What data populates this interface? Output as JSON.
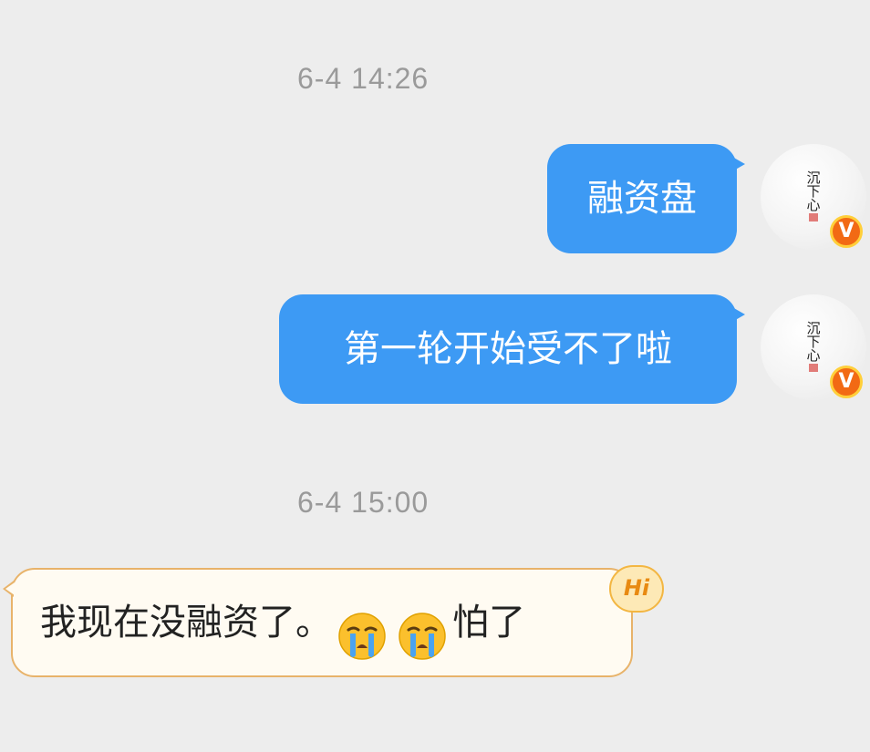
{
  "conversation": {
    "timestamps": [
      "6-4 14:26",
      "6-4 15:00"
    ],
    "messages": [
      {
        "direction": "outgoing",
        "text": "融资盘"
      },
      {
        "direction": "outgoing",
        "text": "第一轮开始受不了啦"
      },
      {
        "direction": "incoming",
        "text_before": "我现在没融资了。",
        "emojis": [
          "crying-face-emoji",
          "crying-face-emoji"
        ],
        "text_after": "怕了"
      }
    ]
  },
  "avatar": {
    "calligraphy": "沉下心",
    "verified_badge": "V"
  },
  "hi_badge": "Hi",
  "colors": {
    "background": "#ededed",
    "outgoing_bubble": "#3d9af4",
    "incoming_bubble": "#fffbf2",
    "incoming_border": "#e8b36a",
    "timestamp_text": "#9a9a9a",
    "verified_badge": "#f26a14"
  },
  "icons": {
    "verified": "verified-v-icon",
    "emoji": "crying-face-emoji",
    "greeting": "hi-badge-icon"
  }
}
